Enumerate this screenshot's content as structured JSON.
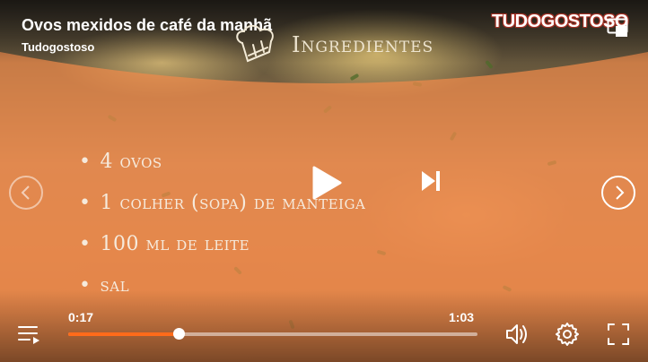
{
  "video": {
    "title": "Ovos mexidos de café da manhã",
    "channel": "Tudogostoso",
    "logo": "TUDOGOSTOSO"
  },
  "card": {
    "heading": "Ingredientes",
    "bullet": "•",
    "items": [
      "4 ovos",
      "1 colher (sopa) de manteiga",
      "100 ml de leite",
      "sal"
    ]
  },
  "playback": {
    "current_time": "0:17",
    "duration": "1:03",
    "progress_fraction": 0.27
  },
  "icons": {
    "playlist": "playlist-icon",
    "pip": "picture-in-picture-icon",
    "play": "play-icon",
    "next": "skip-next-icon",
    "prev": "chevron-left-icon",
    "forward": "chevron-right-icon",
    "volume": "volume-icon",
    "settings": "gear-icon",
    "fullscreen": "fullscreen-icon"
  },
  "colors": {
    "progress": "#ff6b1a",
    "card_overlay": "#f08a4b"
  }
}
